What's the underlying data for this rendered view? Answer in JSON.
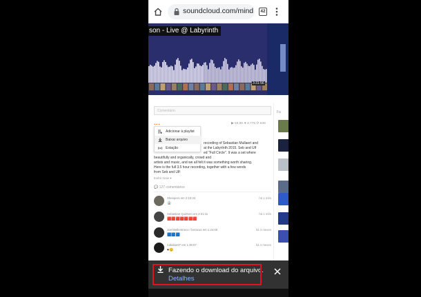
{
  "browser": {
    "url": "soundcloud.com/mind",
    "tab_count": "42"
  },
  "hero": {
    "title": "son - Live @ Labyrinth",
    "duration_label": "3:31:56"
  },
  "track": {
    "comment_placeholder": "Comentário",
    "more_label": "···",
    "stats": "▶ 59,8K   ♥ 2.776   ⟳ 538"
  },
  "more_menu": {
    "items": [
      {
        "label": "Adicionar à playlist"
      },
      {
        "label": "Baixar arquivo"
      },
      {
        "label": "Estação"
      }
    ]
  },
  "description": {
    "lines": [
      "recording of Sebastian Mullaert and",
      "at the LabyrInth 2015. Seb and Ulf",
      "ed \"Full Circle\". It was a set where",
      "beautifully and organically, crowd and",
      "artists and music, and we all felt it was something worth sharing.",
      "",
      "Here is the full 3.5 hour recording, together with a few words",
      "from Seb and Ulf:"
    ],
    "show_more": "Exibir mais ▾"
  },
  "comments": {
    "count_label": "💬 127 comentários",
    "items": [
      {
        "author": "Sheepers",
        "meta": "em 2:10:34",
        "text": "👔",
        "ago": "há 1 mês"
      },
      {
        "author": "Sebastian Quintero",
        "meta": "em 2:01:11",
        "text": "🟥🟥🟥🟥🟥🟥🟥",
        "ago": "há 1 mês"
      },
      {
        "author": "Joel Bellentrieco / heracus",
        "meta": "em 1:24:00",
        "text": "🟦🟦🟦",
        "ago": "há 3 meses"
      },
      {
        "author": "rubidian97",
        "meta": "em 1:38:07",
        "text": "♥😊",
        "ago": "há 4 meses"
      }
    ]
  },
  "sidebar": {
    "header": "Fa"
  },
  "snackbar": {
    "message": "Fazendo o download do arquivo.",
    "action": "Detalhes"
  },
  "colors": {
    "accent": "#ff5500",
    "snackbar_bg": "#323232",
    "snackbar_link": "#8ab4f8",
    "highlight_box": "#e0141e"
  }
}
